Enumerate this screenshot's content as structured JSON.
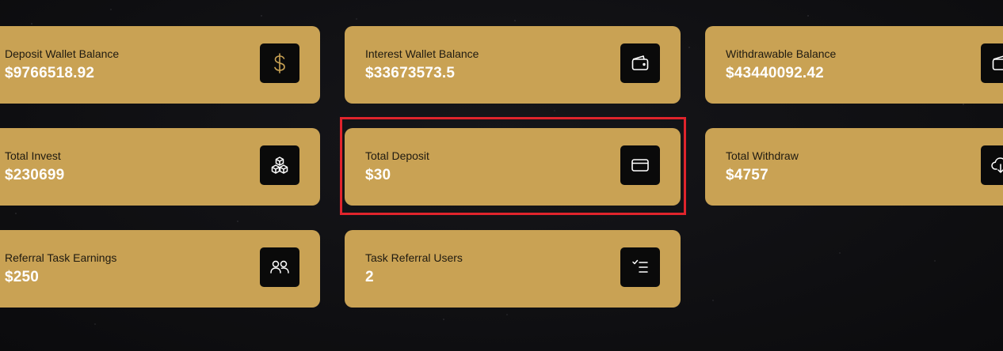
{
  "cards": [
    {
      "label": "Deposit Wallet Balance",
      "value": "$9766518.92",
      "icon": "dollar-icon"
    },
    {
      "label": "Interest Wallet Balance",
      "value": "$33673573.5",
      "icon": "wallet-icon"
    },
    {
      "label": "Withdrawable Balance",
      "value": "$43440092.42",
      "icon": "wallet-icon"
    },
    {
      "label": "Total Invest",
      "value": "$230699",
      "icon": "cubes-icon"
    },
    {
      "label": "Total Deposit",
      "value": "$30",
      "icon": "credit-card-icon"
    },
    {
      "label": "Total Withdraw",
      "value": "$4757",
      "icon": "cloud-download-icon"
    },
    {
      "label": "Referral Task Earnings",
      "value": "$250",
      "icon": "users-icon"
    },
    {
      "label": "Task Referral Users",
      "value": "2",
      "icon": "checklist-icon"
    }
  ],
  "colors": {
    "background": "#0d0d0f",
    "card": "#c9a254",
    "icon_box": "#0a0a0a",
    "icon_stroke": "#c9a254",
    "highlight": "#e0242c"
  }
}
